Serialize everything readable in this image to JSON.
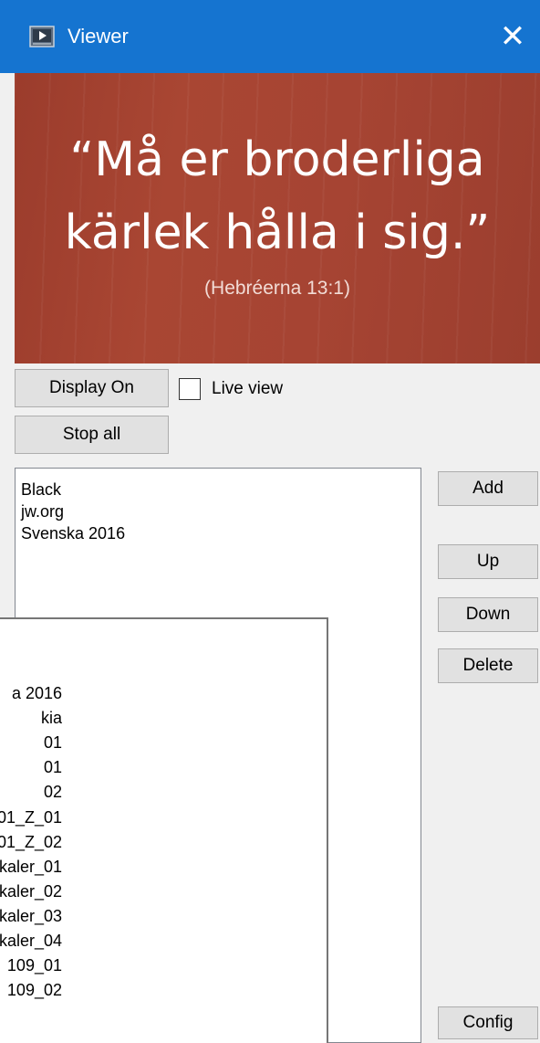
{
  "window": {
    "title": "Viewer",
    "close_glyph": "✕",
    "icon": "media-player-icon"
  },
  "preview": {
    "quote_line1": "“Må er broderliga",
    "quote_line2": "kärlek hålla i sig.”",
    "reference": "(Hebréerna 13:1)",
    "background_color": "#a64433"
  },
  "controls": {
    "display_on": "Display On",
    "stop_all": "Stop all",
    "live_view": "Live view",
    "live_view_checked": false
  },
  "list": {
    "items": [
      "Black",
      "jw.org",
      "Svenska 2016"
    ]
  },
  "side_buttons": {
    "add": "Add",
    "up": "Up",
    "down": "Down",
    "delete": "Delete",
    "config": "Config"
  },
  "dropdown": {
    "items": [
      "a 2016",
      "kia",
      "01",
      "01",
      "02",
      "01_Z_01",
      "01_Z_02",
      "kaler_01",
      "kaler_02",
      "kaler_03",
      "kaler_04",
      "109_01",
      "109_02"
    ]
  }
}
